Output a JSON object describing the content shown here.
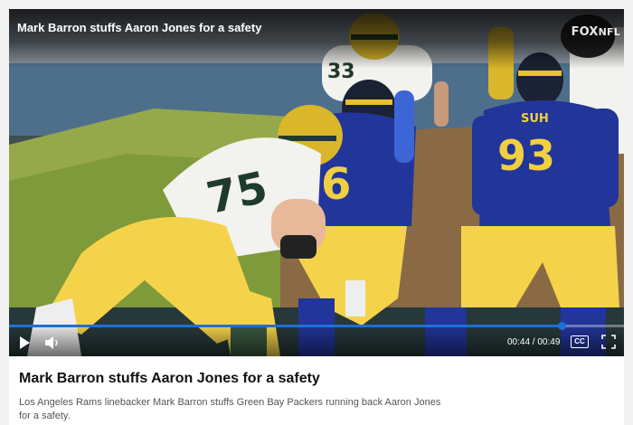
{
  "video": {
    "title": "Mark Barron stuffs Aaron Jones for a safety",
    "network_logo": {
      "fox": "FOX",
      "nfl": "NFL"
    },
    "scene": {
      "jersey_numbers": [
        "75",
        "6",
        "93",
        "33"
      ],
      "nameplates": [
        "SUH"
      ]
    },
    "player_controls": {
      "play_icon": "play-icon",
      "volume_icon": "volume-icon",
      "current_time": "00:44",
      "duration": "00:49",
      "time_display": "00:44 / 00:49",
      "progress_fraction": 0.898,
      "cc_label": "CC",
      "fullscreen_icon": "fullscreen-icon",
      "accent_color": "#1e6fd9"
    }
  },
  "article": {
    "headline": "Mark Barron stuffs Aaron Jones for a safety",
    "description": "Los Angeles Rams linebacker Mark Barron stuffs Green Bay Packers running back Aaron Jones for a safety."
  }
}
